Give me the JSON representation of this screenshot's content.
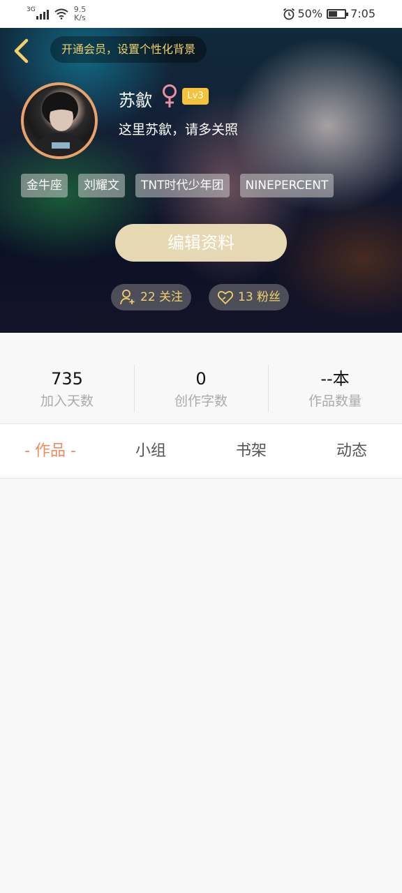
{
  "status_bar": {
    "network": "3G",
    "speed_value": "9.5",
    "speed_unit": "K/s",
    "battery": "50%",
    "battery_level": 0.5,
    "time": "7:05",
    "icons": [
      "signal-icon",
      "wifi-icon",
      "alarm-icon",
      "battery-icon"
    ]
  },
  "header": {
    "vip_prompt": "开通会员，设置个性化背景",
    "username": "苏歙",
    "gender_icon": "female-icon",
    "level": "Lv3",
    "bio": "这里苏歙，请多关照",
    "tags": [
      "金牛座",
      "刘耀文",
      "TNT时代少年团",
      "NINEPERCENT"
    ],
    "edit_button": "编辑资料",
    "following": "22 关注",
    "followers": "13 粉丝",
    "colors": {
      "accent": "#f3d168",
      "edit_button": "#e6d8b2",
      "level_badge": "#f4c23b",
      "avatar_ring": "#e9a36a"
    }
  },
  "stats": [
    {
      "value": "735",
      "label": "加入天数"
    },
    {
      "value": "0",
      "label": "创作字数"
    },
    {
      "value": "--本",
      "label": "作品数量"
    }
  ],
  "tabs": [
    {
      "label": "- 作品 -",
      "active": true
    },
    {
      "label": "小组",
      "active": false
    },
    {
      "label": "书架",
      "active": false
    },
    {
      "label": "动态",
      "active": false
    }
  ],
  "colors": {
    "active_tab": "#f08a5d"
  }
}
